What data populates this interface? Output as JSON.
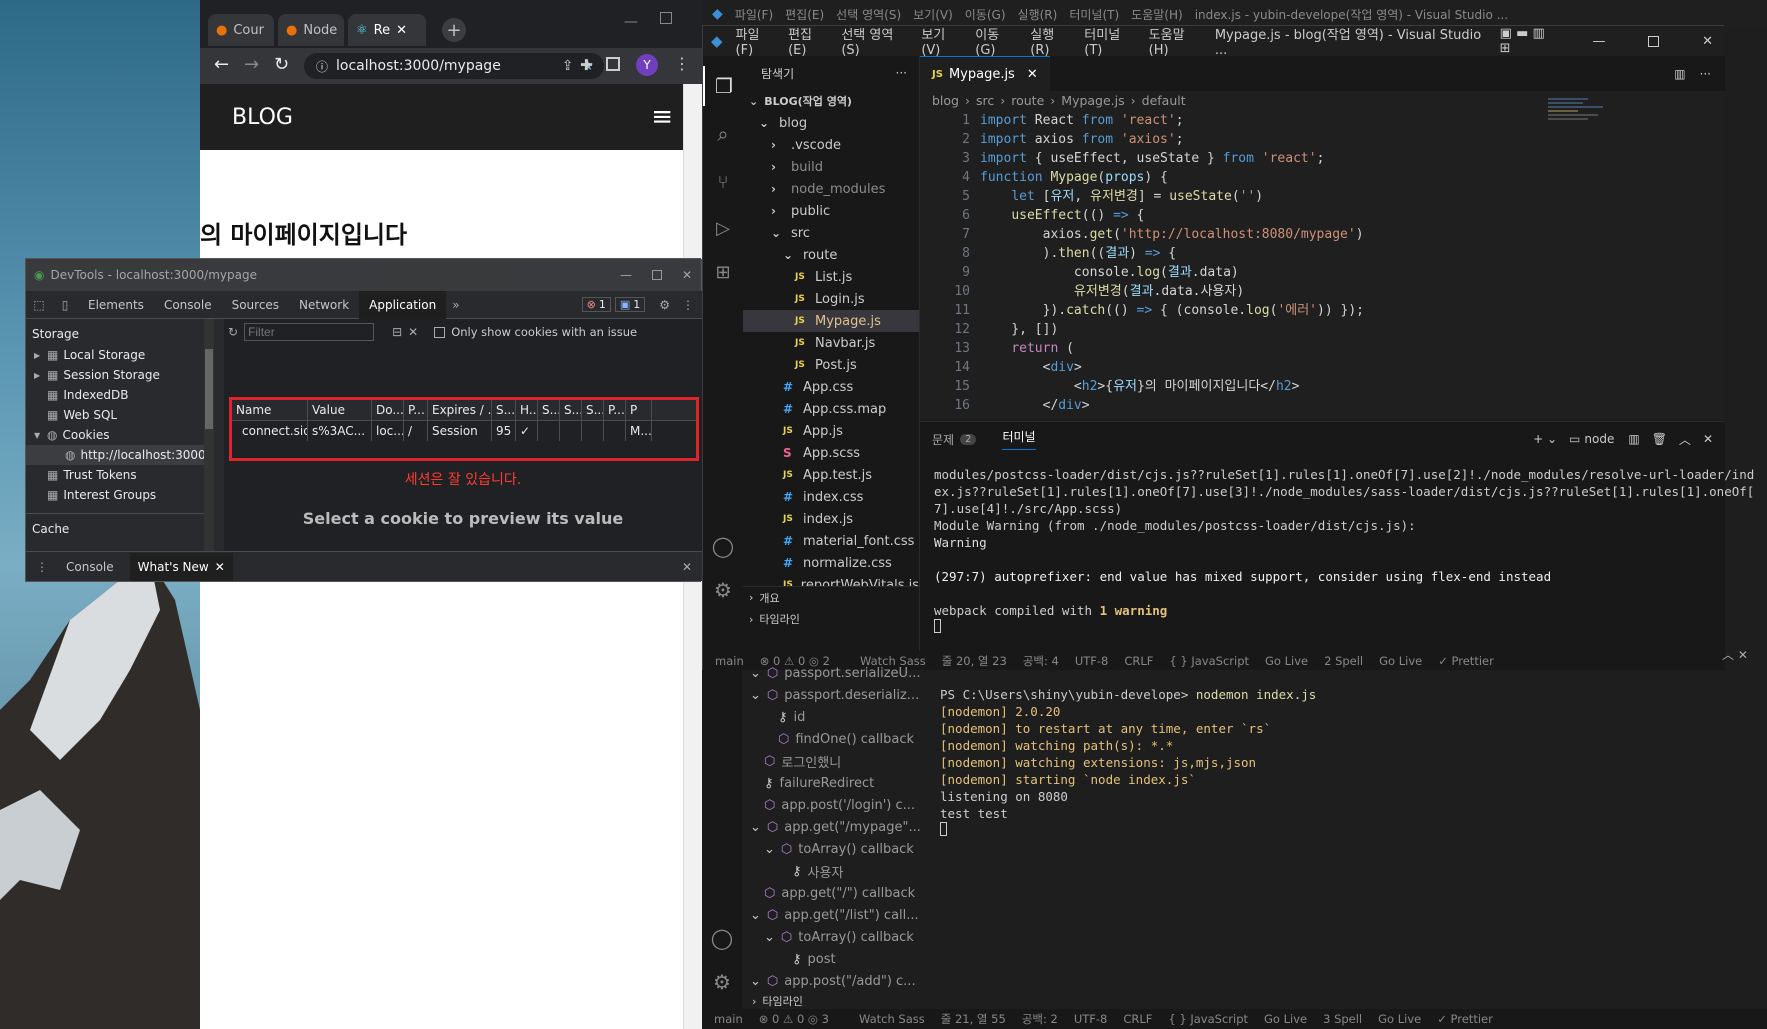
{
  "desktop": {
    "bg": "#3a6a86"
  },
  "vscode_back": {
    "menu": [
      "파일(F)",
      "편집(E)",
      "선택 영역(S)",
      "보기(V)",
      "이동(G)",
      "실행(R)",
      "터미널(T)",
      "도움말(H)"
    ],
    "title": "index.js - yubin-develope(작업 영역) - Visual Studio ...",
    "tree": [
      {
        "label": "passport.serializeU...",
        "depth": 0,
        "open": true
      },
      {
        "label": "passport.deserializ...",
        "depth": 0,
        "open": true
      },
      {
        "label": "id",
        "depth": 1,
        "icon": "key"
      },
      {
        "label": "findOne() callback",
        "depth": 1,
        "icon": "cube"
      },
      {
        "label": "로그인했니",
        "depth": 0,
        "icon": "cube"
      },
      {
        "label": "failureRedirect",
        "depth": 0,
        "icon": "key"
      },
      {
        "label": "app.post('/login') c...",
        "depth": 0,
        "icon": "cube"
      },
      {
        "label": "app.get(\"/mypage\"...",
        "depth": 0,
        "open": true,
        "icon": "cube"
      },
      {
        "label": "toArray() callback",
        "depth": 1,
        "open": true,
        "icon": "cube"
      },
      {
        "label": "사용자",
        "depth": 2,
        "icon": "key"
      },
      {
        "label": "app.get(\"/\") callback",
        "depth": 0,
        "icon": "cube"
      },
      {
        "label": "app.get(\"/list\") call...",
        "depth": 0,
        "open": true,
        "icon": "cube"
      },
      {
        "label": "toArray() callback",
        "depth": 1,
        "open": true,
        "icon": "cube"
      },
      {
        "label": "post",
        "depth": 2,
        "icon": "key"
      },
      {
        "label": "app.post(\"/add\") c...",
        "depth": 0,
        "open": true,
        "icon": "cube"
      }
    ],
    "timeline": "타임라인",
    "terminal": [
      {
        "t": "PS C:\\Users\\shiny\\yubin-develope> ",
        "c": "nodemon index.js"
      },
      {
        "t": "[nodemon] 2.0.20",
        "c": ""
      },
      {
        "t": "[nodemon] to restart at any time, enter `rs`",
        "c": ""
      },
      {
        "t": "[nodemon] watching path(s): *.*",
        "c": ""
      },
      {
        "t": "[nodemon] watching extensions: js,mjs,json",
        "c": ""
      },
      {
        "t": "[nodemon] starting `node index.js`",
        "c": ""
      },
      {
        "t": "listening on 8080",
        "c": ""
      },
      {
        "t": "test test",
        "c": ""
      }
    ],
    "status": {
      "branch": "main",
      "errors": "⊗ 0 ⚠ 0 ◎ 3",
      "watch": "Watch Sass",
      "pos": "줄 21, 열 55",
      "spaces": "공백: 2",
      "enc": "UTF-8",
      "eol": "CRLF",
      "lang": "{ } JavaScript",
      "golive1": "Go Live",
      "spell": "3 Spell",
      "golive2": "Go Live",
      "prettier": "✓ Prettier"
    }
  },
  "chrome": {
    "tabs": [
      {
        "label": "Cour"
      },
      {
        "label": "Node"
      },
      {
        "label": "Re"
      }
    ],
    "url": "localhost:3000/mypage",
    "profile": "Y",
    "blog_title": "BLOG",
    "page_heading": "의 마이페이지입니다"
  },
  "devtools": {
    "title": "DevTools - localhost:3000/mypage",
    "tabs": [
      "Elements",
      "Console",
      "Sources",
      "Network",
      "Application"
    ],
    "active_tab": "Application",
    "error_badge": "1",
    "msg_badge": "1",
    "sidebar_header": "Storage",
    "sidebar": [
      {
        "label": "Local Storage",
        "arrow": "▶",
        "indent": 0
      },
      {
        "label": "Session Storage",
        "arrow": "▶",
        "indent": 0
      },
      {
        "label": "IndexedDB",
        "arrow": "",
        "indent": 0
      },
      {
        "label": "Web SQL",
        "arrow": "",
        "indent": 0
      },
      {
        "label": "Cookies",
        "arrow": "▼",
        "indent": 0
      },
      {
        "label": "http://localhost:3000",
        "arrow": "",
        "indent": 1
      },
      {
        "label": "Trust Tokens",
        "arrow": "",
        "indent": 0
      },
      {
        "label": "Interest Groups",
        "arrow": "",
        "indent": 0
      }
    ],
    "cache_label": "Cache",
    "filter_placeholder": "Filter",
    "only_issue": "Only show cookies with an issue",
    "columns": [
      "Name",
      "Value",
      "Do...",
      "P...",
      "Expires / ...",
      "S...",
      "H...",
      "S...",
      "S...",
      "S...",
      "P...",
      "P"
    ],
    "cookie": [
      "connect.sid",
      "s%3AC...",
      "loc...",
      "/",
      "Session",
      "95",
      "✓",
      "",
      "",
      "",
      "",
      "M..."
    ],
    "annotation": "세션은 잘 있습니다.",
    "preview": "Select a cookie to preview its value",
    "bottom_tabs": [
      "Console",
      "What's New"
    ]
  },
  "vscode": {
    "menu": [
      "파일(F)",
      "편집(E)",
      "선택 영역(S)",
      "보기(V)",
      "이동(G)",
      "실행(R)",
      "터미널(T)",
      "도움말(H)"
    ],
    "title": "Mypage.js - blog(작업 영역) - Visual Studio ...",
    "explorer_title": "탐색기",
    "workspace": "BLOG(작업 영역)",
    "files": [
      {
        "label": "blog",
        "indent": 0,
        "kind": "folder-open"
      },
      {
        "label": ".vscode",
        "indent": 1,
        "kind": "folder"
      },
      {
        "label": "build",
        "indent": 1,
        "kind": "folder"
      },
      {
        "label": "node_modules",
        "indent": 1,
        "kind": "folder"
      },
      {
        "label": "public",
        "indent": 1,
        "kind": "folder"
      },
      {
        "label": "src",
        "indent": 1,
        "kind": "folder-open"
      },
      {
        "label": "route",
        "indent": 2,
        "kind": "folder-open"
      },
      {
        "label": "List.js",
        "indent": 3,
        "kind": "js"
      },
      {
        "label": "Login.js",
        "indent": 3,
        "kind": "js"
      },
      {
        "label": "Mypage.js",
        "indent": 3,
        "kind": "js",
        "active": true
      },
      {
        "label": "Navbar.js",
        "indent": 3,
        "kind": "js"
      },
      {
        "label": "Post.js",
        "indent": 3,
        "kind": "js"
      },
      {
        "label": "App.css",
        "indent": 2,
        "kind": "css"
      },
      {
        "label": "App.css.map",
        "indent": 2,
        "kind": "map"
      },
      {
        "label": "App.js",
        "indent": 2,
        "kind": "js"
      },
      {
        "label": "App.scss",
        "indent": 2,
        "kind": "scss"
      },
      {
        "label": "App.test.js",
        "indent": 2,
        "kind": "js"
      },
      {
        "label": "index.css",
        "indent": 2,
        "kind": "css"
      },
      {
        "label": "index.js",
        "indent": 2,
        "kind": "js"
      },
      {
        "label": "material_font.css",
        "indent": 2,
        "kind": "css"
      },
      {
        "label": "normalize.css",
        "indent": 2,
        "kind": "css"
      },
      {
        "label": "reportWebVitals.js",
        "indent": 2,
        "kind": "js"
      }
    ],
    "outline": "개요",
    "timeline": "타임라인",
    "tab": "Mypage.js",
    "breadcrumb": [
      "blog",
      "src",
      "route",
      "Mypage.js",
      "default"
    ],
    "panel_tabs": [
      "문제",
      "터미널"
    ],
    "problems_count": "2",
    "terminal_name": "node",
    "terminal": [
      "modules/postcss-loader/dist/cjs.js??ruleSet[1].rules[1].oneOf[7].use[2]!./node_modules/resolve-url-loader/ind",
      "ex.js??ruleSet[1].rules[1].oneOf[7].use[3]!./node_modules/sass-loader/dist/cjs.js??ruleSet[1].rules[1].oneOf[",
      "7].use[4]!./src/App.scss)",
      "Module Warning (from ./node_modules/postcss-loader/dist/cjs.js):",
      "Warning",
      "",
      "(297:7) autoprefixer: end value has mixed support, consider using flex-end instead",
      "",
      "webpack compiled with "
    ],
    "terminal_warn": "1 warning",
    "status": {
      "branch": "main",
      "errors": "⊗ 0 ⚠ 0 ◎ 2",
      "watch": "Watch Sass",
      "pos": "줄 20, 열 23",
      "spaces": "공백: 4",
      "enc": "UTF-8",
      "eol": "CRLF",
      "lang": "{ } JavaScript",
      "golive1": "Go Live",
      "spell": "2 Spell",
      "golive2": "Go Live",
      "prettier": "✓ Prettier"
    }
  }
}
